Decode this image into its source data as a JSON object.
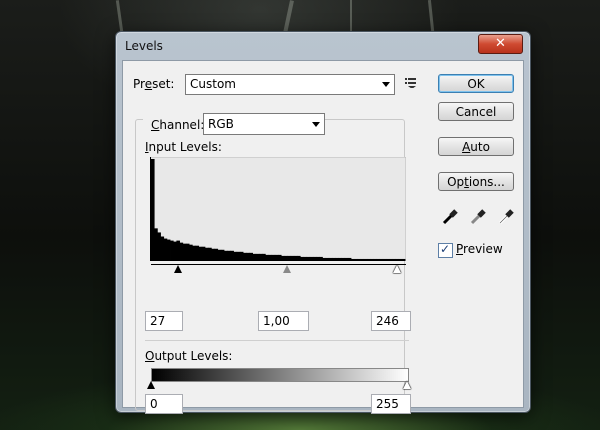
{
  "window": {
    "title": "Levels",
    "close_glyph": "✕"
  },
  "preset": {
    "label_prefix": "Pr",
    "label_accel": "e",
    "label_suffix": "set:",
    "value": "Custom",
    "menu_icon": "preset-options-icon"
  },
  "channel": {
    "label_accel": "C",
    "label_suffix": "hannel:",
    "value": "RGB"
  },
  "input_levels": {
    "label_accel": "I",
    "label_suffix": "nput Levels:",
    "black": "27",
    "gamma": "1,00",
    "white": "246",
    "black_fraction": 0.106,
    "gamma_fraction": 0.534,
    "white_fraction": 0.965
  },
  "output_levels": {
    "label_accel": "O",
    "label_suffix": "utput Levels:",
    "black": "0",
    "white": "255"
  },
  "buttons": {
    "ok": "OK",
    "cancel": "Cancel",
    "auto_accel": "A",
    "auto_suffix": "uto",
    "options_prefix": "Op",
    "options_accel": "t",
    "options_suffix": "ions..."
  },
  "preview": {
    "checked": true,
    "label_accel": "P",
    "label_suffix": "review"
  },
  "eyedroppers": [
    "black-eyedropper-icon",
    "gray-eyedropper-icon",
    "white-eyedropper-icon"
  ],
  "histogram": {
    "levels": [
      1.0,
      0.32,
      0.28,
      0.24,
      0.22,
      0.21,
      0.2,
      0.19,
      0.2,
      0.18,
      0.17,
      0.17,
      0.16,
      0.15,
      0.15,
      0.14,
      0.14,
      0.13,
      0.13,
      0.12,
      0.12,
      0.11,
      0.11,
      0.1,
      0.1,
      0.1,
      0.09,
      0.09,
      0.09,
      0.08,
      0.08,
      0.08,
      0.07,
      0.07,
      0.07,
      0.07,
      0.06,
      0.06,
      0.06,
      0.06,
      0.06,
      0.05,
      0.05,
      0.05,
      0.05,
      0.05,
      0.05,
      0.04,
      0.04,
      0.04,
      0.04,
      0.04,
      0.04,
      0.04,
      0.03,
      0.03,
      0.03,
      0.03,
      0.03,
      0.03,
      0.03,
      0.03,
      0.03,
      0.02,
      0.02,
      0.02,
      0.02,
      0.02,
      0.02,
      0.02,
      0.02,
      0.02,
      0.02,
      0.02,
      0.02,
      0.02,
      0.02,
      0.02,
      0.02,
      0.02
    ],
    "color": "#000000",
    "background": "#e8e8e8"
  },
  "colors": {
    "accent": "#3c7fb1",
    "close": "#cf4a31"
  }
}
